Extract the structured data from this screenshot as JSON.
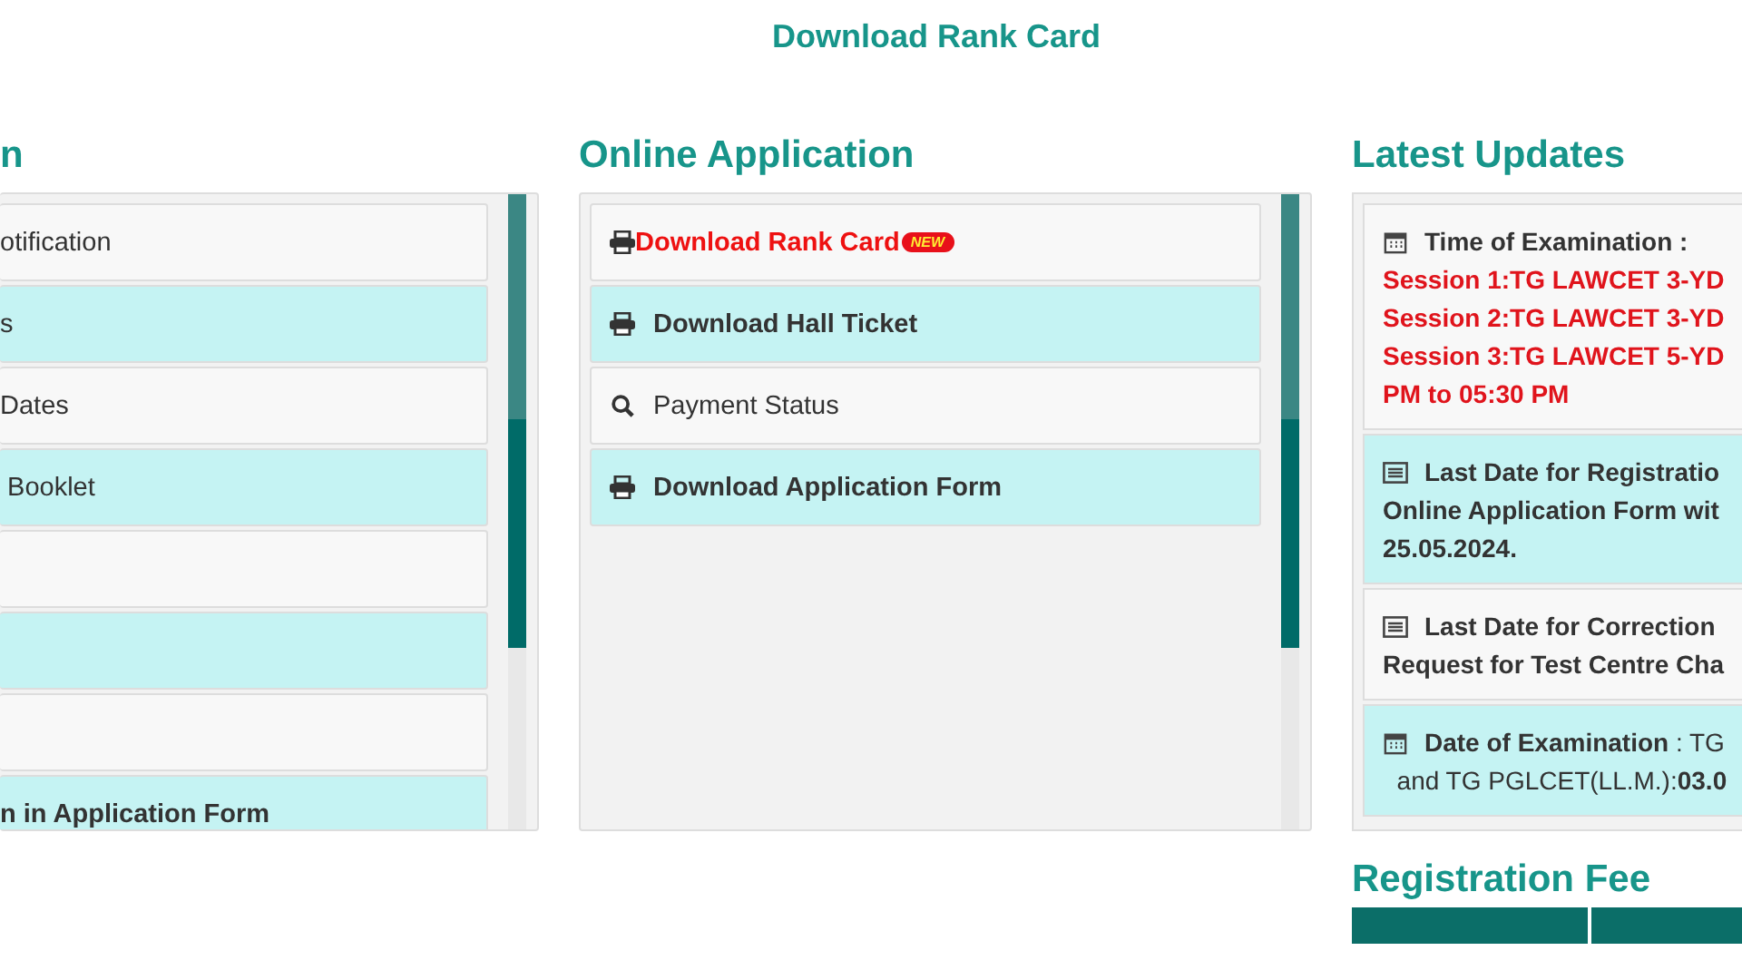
{
  "top_link": "Download Rank Card",
  "columns": [
    {
      "heading": "n",
      "items": [
        {
          "kind": "plain",
          "text": "otification"
        },
        {
          "kind": "plain",
          "text": "s"
        },
        {
          "kind": "plain",
          "text": "Dates"
        },
        {
          "kind": "plain",
          "text": " Booklet"
        },
        {
          "kind": "blank"
        },
        {
          "kind": "blank"
        },
        {
          "kind": "blank"
        },
        {
          "kind": "bold",
          "text": "n in Application Form"
        }
      ]
    },
    {
      "heading": "Online Application",
      "items": [
        {
          "kind": "print_new",
          "text": "Download Rank Card",
          "badge": "NEW"
        },
        {
          "kind": "print",
          "text": "Download Hall Ticket"
        },
        {
          "kind": "search",
          "text": "Payment Status"
        },
        {
          "kind": "print",
          "text": "Download Application Form"
        }
      ]
    }
  ],
  "updates": {
    "heading": "Latest Updates",
    "items": [
      {
        "kind": "calendar",
        "lines": [
          "**Time of Examination :**"
        ],
        "alert_lines": [
          "Session 1:TG LAWCET 3-YD",
          "Session 2:TG LAWCET 3-YD",
          "Session 3:TG LAWCET 5-YD",
          "PM to 05:30 PM"
        ]
      },
      {
        "kind": "list",
        "lines": [
          "**Last Date for Registratio**",
          "**Online Application Form wit**",
          "**25.05.2024.**"
        ]
      },
      {
        "kind": "list",
        "lines": [
          "**Last Date for Correction**",
          "**Request for Test Centre Cha**"
        ]
      },
      {
        "kind": "calendar",
        "lines": [
          "**Date of Examination** : TG",
          "  and TG PGLCET(LL.M.):**03.0**"
        ]
      }
    ]
  },
  "fee": {
    "heading": "Registration Fee"
  }
}
